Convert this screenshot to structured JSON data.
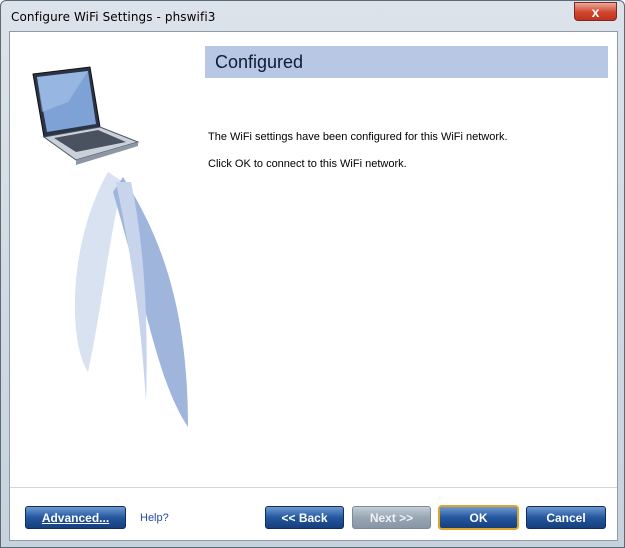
{
  "window": {
    "title": "Configure WiFi Settings - phswifi3",
    "close_glyph": "x"
  },
  "header": {
    "title": "Configured"
  },
  "content": {
    "line1": "The WiFi settings have been configured for this WiFi network.",
    "line2": "Click OK to connect to this WiFi network."
  },
  "footer": {
    "advanced_label": "Advanced...",
    "help_label": "Help?",
    "back_label": "<< Back",
    "next_label": "Next >>",
    "ok_label": "OK",
    "cancel_label": "Cancel",
    "next_disabled": true
  },
  "colors": {
    "header_band": "#b8c7e3",
    "button_blue": "#23579f",
    "button_disabled": "#98a5b3",
    "ok_focus": "#e0a32b"
  },
  "icons": [
    "laptop-illustration",
    "close-icon"
  ]
}
